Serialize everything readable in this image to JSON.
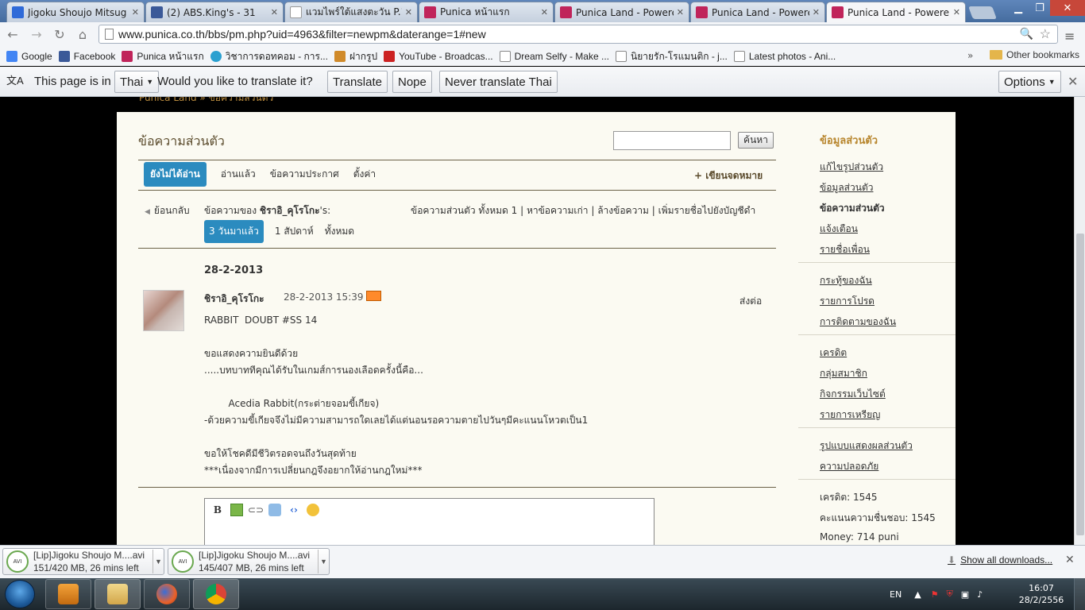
{
  "browser": {
    "tabs": [
      {
        "title": "Jigoku Shoujo Mitsug",
        "color": "#2f6ad8"
      },
      {
        "title": "(2) ABS.King's - 31",
        "color": "#3b5998"
      },
      {
        "title": "แวมไพร์ใต้แสงตะวัน P.1",
        "color": "#cccccc"
      },
      {
        "title": "Punica หน้าแรก",
        "color": "#c0245a"
      },
      {
        "title": "Punica Land - Powere",
        "color": "#c0245a"
      },
      {
        "title": "Punica Land - Powere",
        "color": "#c0245a"
      },
      {
        "title": "Punica Land - Powere",
        "color": "#c0245a"
      }
    ],
    "url": "www.punica.co.th/bbs/pm.php?uid=4963&filter=newpm&daterange=1#new",
    "bookmarks": [
      {
        "label": "Google",
        "color": "#4285f4"
      },
      {
        "label": "Facebook",
        "color": "#3b5998"
      },
      {
        "label": "Punica หน้าแรก",
        "color": "#c0245a"
      },
      {
        "label": "วิชาการดอทคอม - การ...",
        "color": "#2aa0d0"
      },
      {
        "label": "ฝากรูป",
        "color": "#d08a2a"
      },
      {
        "label": "YouTube - Broadcas...",
        "color": "#cc2222"
      },
      {
        "label": "Dream Selfy - Make ...",
        "color": "#ffffff"
      },
      {
        "label": "นิยายรัก-โรแมนติก - j...",
        "color": "#ffffff"
      },
      {
        "label": "Latest photos - Ani...",
        "color": "#ffffff"
      }
    ],
    "other_bookmarks": "Other bookmarks",
    "translate": {
      "prefix": "This page is in",
      "language": "Thai",
      "question": "Would you like to translate it?",
      "translate_btn": "Translate",
      "nope_btn": "Nope",
      "never_btn": "Never translate Thai",
      "options_btn": "Options"
    }
  },
  "page": {
    "breadcrumb": "Punica Land » ข้อความส่วนตัว",
    "title": "ข้อความส่วนตัว",
    "search_button": "ค้นหา",
    "tabs": [
      "ยังไม่ได้อ่าน",
      "อ่านแล้ว",
      "ข้อความประกาศ",
      "ตั้งค่า"
    ],
    "compose": "+ เขียนจดหมาย",
    "back": "ย้อนกลับ",
    "messages_of_prefix": "ข้อความของ",
    "messages_of_user": "ชิราอิ_คุโรโกะ",
    "messages_of_suffix": "'s:",
    "pm_links": "ข้อความส่วนตัว ทั้งหมด 1  |  หาข้อความเก่า   |  ล้างข้อความ   |  เพิ่มรายชื่อไปยังบัญชีดำ",
    "ranges": [
      "3 วันมาแล้ว",
      "1 สัปดาห์",
      "ทั้งหมด"
    ],
    "date": "28-2-2013",
    "message": {
      "sender": "ชิราอิ_คุโรโกะ",
      "time": "28-2-2013 15:39",
      "forward": "ส่งต่อ",
      "body": "RABBIT  DOUBT #SS 14\n\nขอแสดงความยินดีด้วย\n.....บทบาททีคุณได้รับในเกมส์การนองเลือดครั้งนี้คือ...\n\n        Acedia Rabbit(กระต่ายจอมขี้เกียจ)\n-ด้วยความขี้เกียจจึงไม่มีความสามารถใดเลยได้แต่นอนรอความตายไปวันๆมีคะแนนโหวตเป็น1\n\nขอให้โชคดีมีชีวิตรอดจนถึงวันสุดท้าย\n***เนื่องจากมีการเปลี่ยนกฎจึงอยากให้อ่านกฎใหม่***"
    },
    "editor_tools": [
      "bold-icon",
      "image-icon",
      "link-icon",
      "quote-icon",
      "code-icon",
      "smiley-icon"
    ],
    "sidebar": {
      "title": "ข้อมูลส่วนตัว",
      "group1": [
        "แก้ไขรูปส่วนตัว",
        "ข้อมูลส่วนตัว",
        "ข้อความส่วนตัว",
        "แจ้งเตือน",
        "รายชื่อเพื่อน"
      ],
      "group2": [
        "กระทู้ของฉัน",
        "รายการโปรด",
        "การติดตามของฉัน"
      ],
      "group3": [
        "เครดิต",
        "กลุ่มสมาชิก",
        "กิจกรรมเว็บไซต์",
        "รายการเหรียญ"
      ],
      "group4": [
        "รูปแบบแสดงผลส่วนตัว",
        "ความปลอดภัย"
      ],
      "stats": [
        "เครดิต: 1545",
        "คะแนนความชื่นชอบ: 1545",
        "Money: 714 puni"
      ]
    }
  },
  "downloads": {
    "items": [
      {
        "name": "[Lip]Jigoku Shoujo M....avi",
        "status": "151/420 MB, 26 mins left",
        "progress": 0.36
      },
      {
        "name": "[Lip]Jigoku Shoujo M....avi",
        "status": "145/407 MB, 26 mins left",
        "progress": 0.36
      }
    ],
    "show_all": "Show all downloads..."
  },
  "taskbar": {
    "lang": "EN",
    "time": "16:07",
    "date": "28/2/2556"
  }
}
